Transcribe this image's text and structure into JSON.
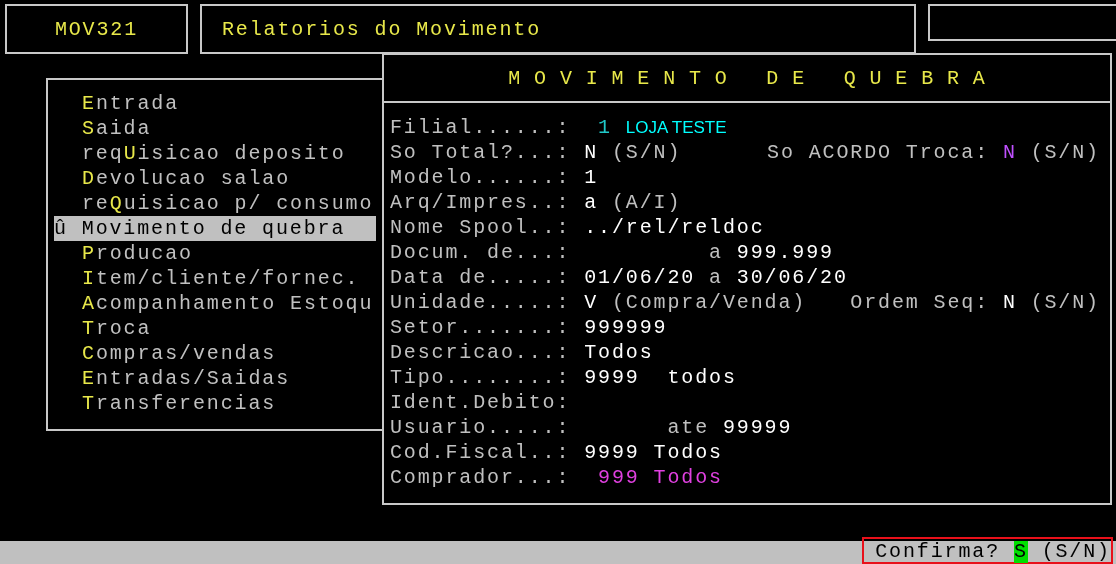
{
  "header": {
    "program": "MOV321",
    "title": "Relatorios do Movimento"
  },
  "menu": {
    "items": [
      {
        "key": "E",
        "after": "ntrada",
        "selected": false
      },
      {
        "key": "S",
        "after": "aida",
        "selected": false
      },
      {
        "before": "req",
        "key": "U",
        "after": "isicao deposito",
        "selected": false
      },
      {
        "key": "D",
        "after": "evolucao salao",
        "selected": false
      },
      {
        "before": "re",
        "key": "Q",
        "after": "uisicao p/ consumo",
        "selected": false
      },
      {
        "marker": "û",
        "key": "M",
        "after": "ovimento de quebra",
        "selected": true
      },
      {
        "key": "P",
        "after": "roducao",
        "selected": false
      },
      {
        "key": "I",
        "after": "tem/cliente/fornec.",
        "selected": false
      },
      {
        "key": "A",
        "after": "companhamento Estoqu",
        "selected": false
      },
      {
        "key": "T",
        "after": "roca",
        "selected": false
      },
      {
        "key": "C",
        "after": "ompras/vendas",
        "selected": false
      },
      {
        "key": "E",
        "after": "ntradas/Saidas",
        "selected": false
      },
      {
        "key": "T",
        "after": "ransferencias",
        "selected": false
      }
    ]
  },
  "form": {
    "title": "M O V I M E N T O   D E   Q U E B R A",
    "rows": [
      {
        "label": "Filial......:",
        "values": [
          {
            "text": " 1",
            "color": "#20c8c8",
            "kind": "mono"
          },
          {
            "text": "LOJA TESTE",
            "color": "#00ffff",
            "kind": "sans"
          }
        ]
      },
      {
        "label": "So Total?...:",
        "values": [
          {
            "text": "N",
            "color": "#ffffff",
            "kind": "mono"
          },
          {
            "text": "(S/N)",
            "color": "#c0c0c0",
            "kind": "mono"
          }
        ],
        "extra": {
          "label": "So ACORDO Troca:",
          "values": [
            {
              "text": "N",
              "color": "#c050ff",
              "kind": "mono"
            },
            {
              "text": "(S/N)",
              "color": "#c0c0c0",
              "kind": "mono"
            }
          ]
        }
      },
      {
        "label": "Modelo......:",
        "values": [
          {
            "text": "1",
            "color": "#ffffff",
            "kind": "mono"
          }
        ]
      },
      {
        "label": "Arq/Impres..:",
        "values": [
          {
            "text": "a",
            "color": "#ffffff",
            "kind": "mono"
          },
          {
            "text": "(A/I)",
            "color": "#c0c0c0",
            "kind": "mono"
          }
        ]
      },
      {
        "label": "Nome Spool..:",
        "values": [
          {
            "text": "../rel/reldoc",
            "color": "#ffffff",
            "kind": "mono"
          }
        ]
      },
      {
        "label": "Docum. de...:",
        "values": [
          {
            "text": "         a",
            "color": "#c0c0c0",
            "kind": "mono"
          },
          {
            "text": "999.999",
            "color": "#ffffff",
            "kind": "mono"
          }
        ]
      },
      {
        "label": "Data de.....:",
        "values": [
          {
            "text": "01/06/20",
            "color": "#ffffff",
            "kind": "mono"
          },
          {
            "text": "a",
            "color": "#c0c0c0",
            "kind": "mono"
          },
          {
            "text": "30/06/20",
            "color": "#ffffff",
            "kind": "mono"
          }
        ]
      },
      {
        "label": "Unidade.....:",
        "values": [
          {
            "text": "V",
            "color": "#ffffff",
            "kind": "mono"
          },
          {
            "text": "(Compra/Venda)",
            "color": "#c0c0c0",
            "kind": "mono"
          }
        ],
        "extra": {
          "label": "Ordem Seq:",
          "values": [
            {
              "text": "N",
              "color": "#ffffff",
              "kind": "mono"
            },
            {
              "text": "(S/N)",
              "color": "#c0c0c0",
              "kind": "mono"
            }
          ]
        }
      },
      {
        "label": "Setor.......:",
        "values": [
          {
            "text": "999999",
            "color": "#ffffff",
            "kind": "mono"
          }
        ]
      },
      {
        "label": "Descricao...:",
        "values": [
          {
            "text": "Todos",
            "color": "#ffffff",
            "kind": "mono"
          }
        ]
      },
      {
        "label": "Tipo........:",
        "values": [
          {
            "text": "9999  todos",
            "color": "#ffffff",
            "kind": "mono"
          }
        ]
      },
      {
        "label": "Ident.Debito:"
      },
      {
        "label": "Usuario.....:",
        "values": [
          {
            "text": "      ate",
            "color": "#c0c0c0",
            "kind": "mono"
          },
          {
            "text": "99999",
            "color": "#ffffff",
            "kind": "mono"
          }
        ]
      },
      {
        "label": "Cod.Fiscal..:",
        "values": [
          {
            "text": "9999 Todos",
            "color": "#ffffff",
            "kind": "mono"
          }
        ]
      },
      {
        "label": "Comprador...:",
        "values": [
          {
            "text": " 999",
            "color": "#e040e0",
            "kind": "mono"
          },
          {
            "text": "Todos",
            "color": "#e040e0",
            "kind": "mono"
          }
        ]
      }
    ]
  },
  "status_bar": {
    "prompt": "Confirma?",
    "answer": "S",
    "options": "(S/N)"
  }
}
